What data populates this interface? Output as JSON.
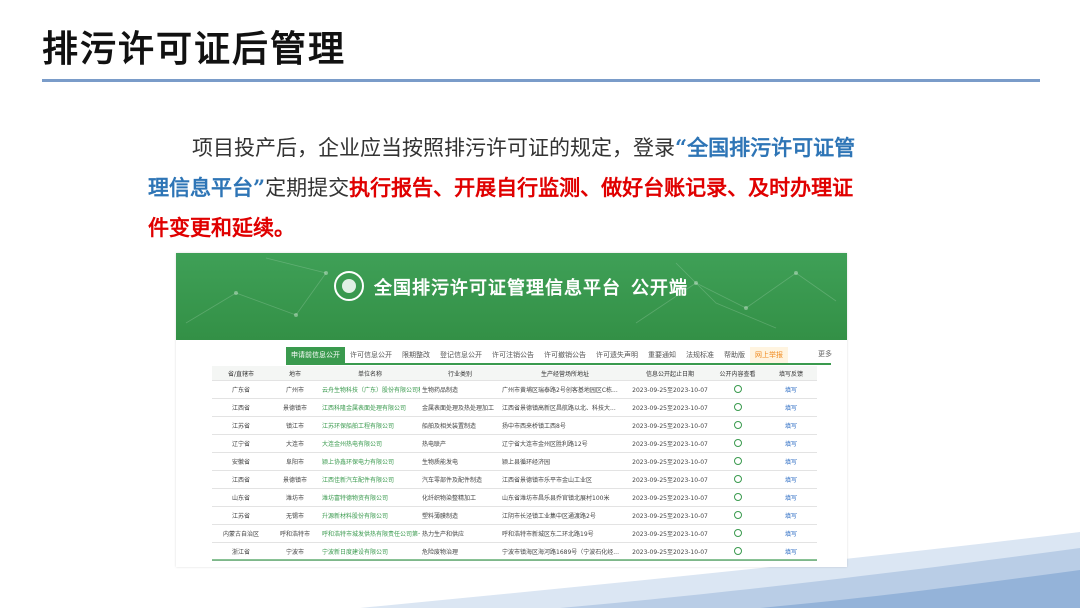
{
  "slide": {
    "title": "排污许可证后管理",
    "para_1": "项目投产后，企业应当按照排污许可证的规定，登录",
    "para_quote": "“全国排污许可证管理信息平台”",
    "para_2": "定期提交",
    "para_red": "执行报告、开展自行监测、做好台账记录、及时办理证件变更和延续。"
  },
  "platform": {
    "title_main": "全国排污许可证管理信息平台",
    "title_sub": "公开端",
    "tabs": [
      "申请前信息公开",
      "许可信息公开",
      "限期整改",
      "登记信息公开",
      "许可注销公告",
      "许可撤销公告",
      "许可遗失声明",
      "重要通知",
      "法规标准",
      "帮助版",
      "网上举报"
    ],
    "more": "更多",
    "columns": [
      "省/直辖市",
      "地市",
      "单位名称",
      "行业类别",
      "生产经营场所地址",
      "信息公开起止日期",
      "公开内容查看",
      "填写反馈"
    ],
    "rows": [
      [
        "广东省",
        "广州市",
        "云舟生物科技（广东）股份有限公司科...",
        "生物药品制造",
        "广州市黄埔区瑞泰路2号创客基地园区C栋...",
        "2023-09-25至2023-10-07",
        "填写"
      ],
      [
        "江西省",
        "景德镇市",
        "江西科隆金属表面处理有限公司",
        "金属表面处理及热处理加工",
        "江西省景德镇高新区昌航路以北、科技大...",
        "2023-09-25至2023-10-07",
        "填写"
      ],
      [
        "江苏省",
        "镇江市",
        "江苏环保船舶工程有限公司",
        "船舶及相关装置制造",
        "扬中市西来桥镇工西8号",
        "2023-09-25至2023-10-07",
        "填写"
      ],
      [
        "辽宁省",
        "大连市",
        "大连金州热电有限公司",
        "热电联产",
        "辽宁省大连市金州区胜利路12号",
        "2023-09-25至2023-10-07",
        "填写"
      ],
      [
        "安徽省",
        "阜阳市",
        "颍上协鑫环保电力有限公司",
        "生物质能发电",
        "颍上县循环经济园",
        "2023-09-25至2023-10-07",
        "填写"
      ],
      [
        "江西省",
        "景德镇市",
        "江西佳新汽车配件有限公司",
        "汽车零部件及配件制造",
        "江西省景德镇市乐平市金山工业区",
        "2023-09-25至2023-10-07",
        "填写"
      ],
      [
        "山东省",
        "潍坊市",
        "潍坊富特德物资有限公司",
        "化纤织物染整精加工",
        "山东省潍坊市昌乐县乔官镇北展村100米",
        "2023-09-25至2023-10-07",
        "填写"
      ],
      [
        "江苏省",
        "无锡市",
        "升源新材料股份有限公司",
        "塑料薄膜制造",
        "江阴市长泾镇工业集中区通渡路2号",
        "2023-09-25至2023-10-07",
        "填写"
      ],
      [
        "内蒙古自治区",
        "呼和浩特市",
        "呼和浩特市城发供热有限责任公司第七...",
        "热力生产和供应",
        "呼和浩特市新城区东二环北路19号",
        "2023-09-25至2023-10-07",
        "填写"
      ],
      [
        "浙江省",
        "宁波市",
        "宁波新日度建设有限公司",
        "危险废物治理",
        "宁波市镇海区海河路1689号（宁波石化经...",
        "2023-09-25至2023-10-07",
        "填写"
      ]
    ]
  },
  "colors": {
    "accent_green": "#3a9a4e",
    "highlight_red": "#e00000",
    "highlight_blue": "#2e75b6",
    "rule_blue": "#7a9cc9"
  }
}
